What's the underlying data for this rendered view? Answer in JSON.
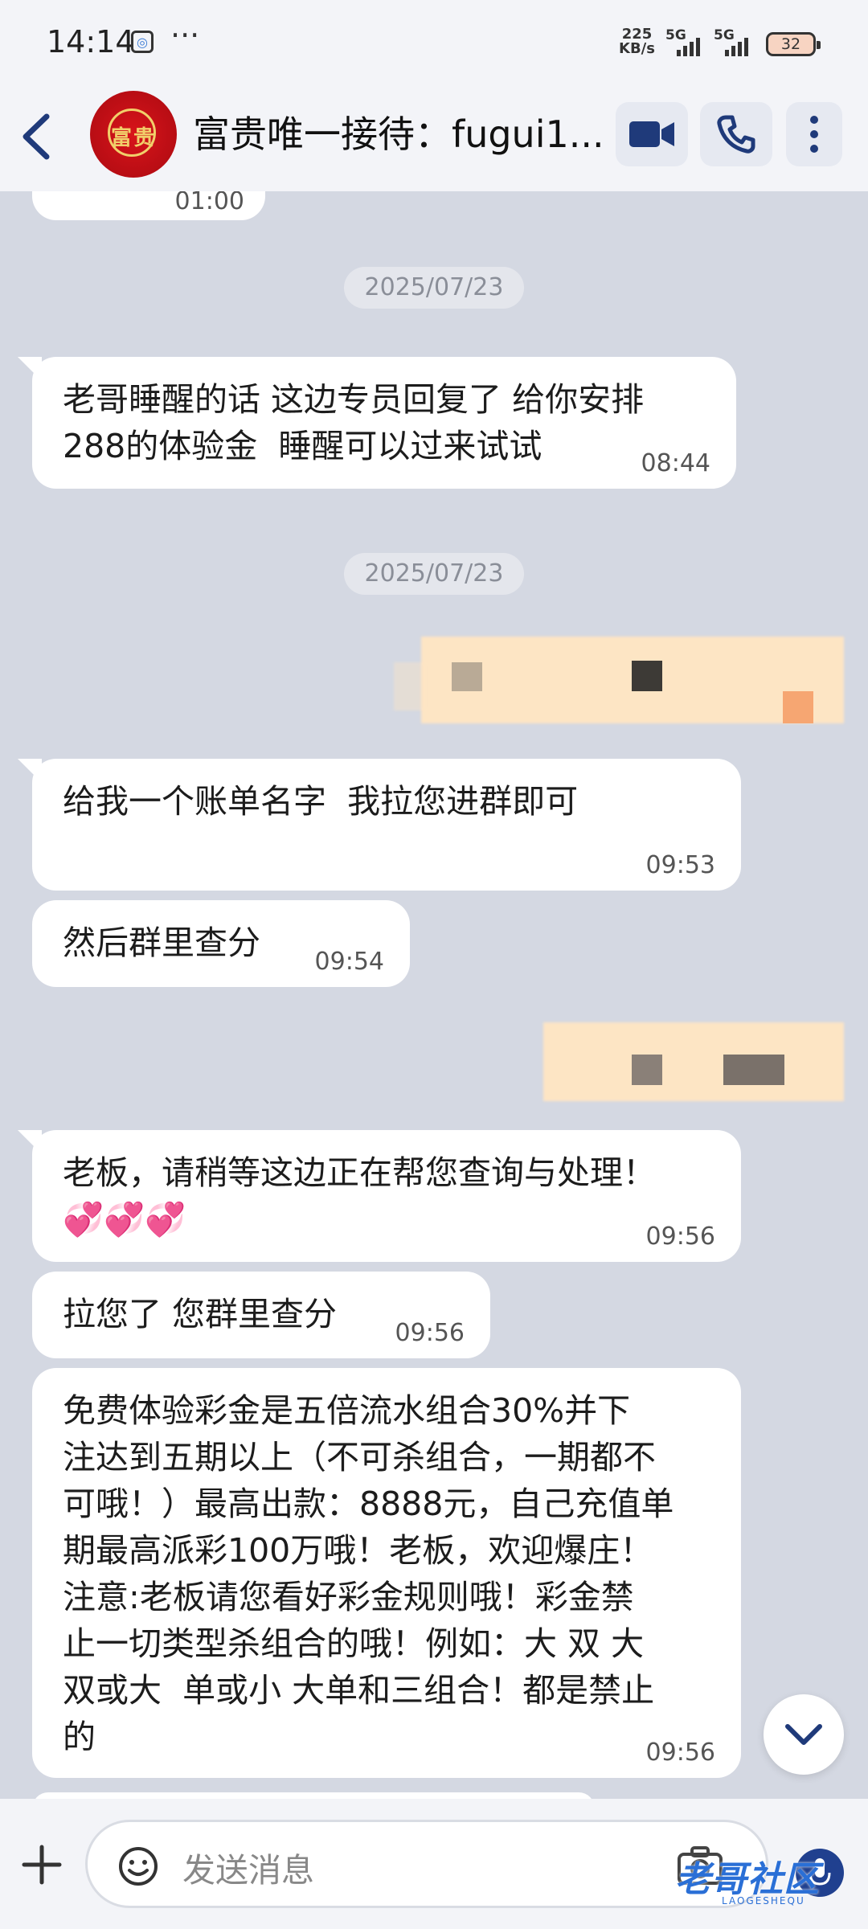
{
  "status": {
    "time": "14:14",
    "dots": "···",
    "speed_top": "225",
    "speed_bottom": "KB/s",
    "net1": "5G",
    "net2": "5G",
    "battery": "32"
  },
  "header": {
    "title": "富贵唯一接待：fugui1...",
    "avatar_text": "富贵"
  },
  "messages": {
    "partial_time": "01:00",
    "date1": "2025/07/23",
    "m1_text": "老哥睡醒的话 这边专员回复了 给你安排\n288的体验金  睡醒可以过来试试",
    "m1_time": "08:44",
    "date2": "2025/07/23",
    "m2_text": "给我一个账单名字  我拉您进群即可",
    "m2_time": "09:53",
    "m3_text": "然后群里查分",
    "m3_time": "09:54",
    "m4_text": "老板，请稍等这边正在帮您查询与处理！\n💞💞💞",
    "m4_time": "09:56",
    "m5_text": "拉您了 您群里查分",
    "m5_time": "09:56",
    "m6_text": "免费体验彩金是五倍流水组合30%并下\n注达到五期以上（不可杀组合，一期都不\n可哦！）最高出款：8888元，自己充值单\n期最高派彩100万哦！老板，欢迎爆庄！\n注意:老板请您看好彩金规则哦！彩金禁\n止一切类型杀组合的哦！例如：大 双 大\n双或大  单或小 大单和三组合！都是禁止\n的",
    "m6_time": "09:56"
  },
  "input": {
    "placeholder": "发送消息"
  },
  "watermark": {
    "main": "老哥社区",
    "sub": "LAOGESHEQU"
  },
  "colors": {
    "accent": "#20408f",
    "background": "#d4d8e2",
    "bubble": "#ffffff",
    "redacted": "#fde5c4"
  },
  "icons": [
    "back-arrow-icon",
    "video-call-icon",
    "phone-icon",
    "more-icon",
    "plus-icon",
    "emoji-icon",
    "camera-icon",
    "mic-icon",
    "chevron-down-icon"
  ]
}
